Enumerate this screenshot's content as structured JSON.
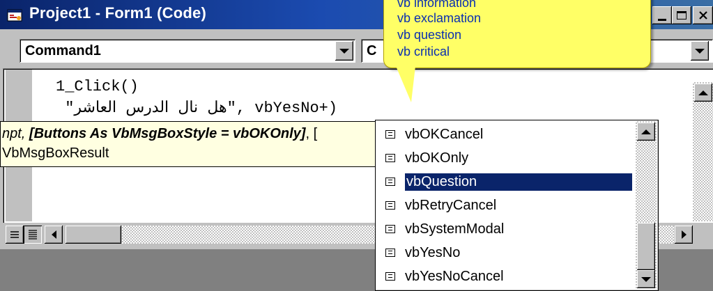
{
  "window": {
    "title": "Project1 - Form1 (Code)"
  },
  "object_combo": {
    "value": "Command1"
  },
  "proc_combo": {
    "value": "C"
  },
  "code_lines": [
    "1_Click()",
    " \"هل نال الدرس العاشر\", vbYesNo+)"
  ],
  "param_tooltip": {
    "line1_prefix": "npt, ",
    "line1_bold": "[Buttons As VbMsgBoxStyle = vbOKOnly]",
    "line1_suffix": ", [",
    "line2": "VbMsgBoxResult"
  },
  "balloon": {
    "lines": [
      "vb information",
      "vb exclamation",
      "vb question",
      "vb critical"
    ]
  },
  "completion_list": {
    "items": [
      {
        "label": "vbOKCancel",
        "selected": false
      },
      {
        "label": "vbOKOnly",
        "selected": false
      },
      {
        "label": "vbQuestion",
        "selected": true
      },
      {
        "label": "vbRetryCancel",
        "selected": false
      },
      {
        "label": "vbSystemModal",
        "selected": false
      },
      {
        "label": "vbYesNo",
        "selected": false
      },
      {
        "label": "vbYesNoCancel",
        "selected": false
      }
    ]
  },
  "colors": {
    "selection": "#0a246a",
    "tooltip_bg": "#ffffe1",
    "balloon_bg": "#ffff66",
    "balloon_text": "#0a2fb0"
  }
}
